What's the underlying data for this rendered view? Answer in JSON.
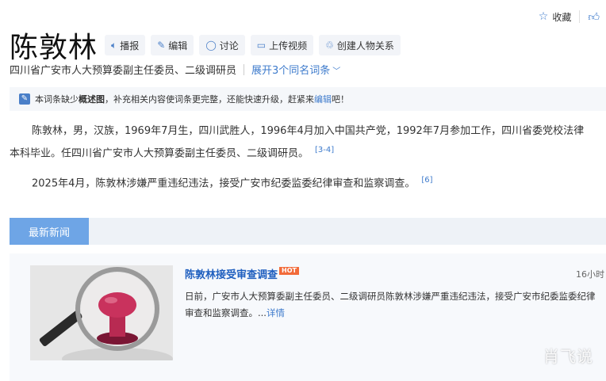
{
  "topbar": {
    "collect_label": "收藏",
    "collect_icon": "star-icon",
    "like_icon": "thumb-up-icon"
  },
  "entry": {
    "title": "陈敦林"
  },
  "actions": [
    {
      "label": "播报",
      "icon": "speaker-icon"
    },
    {
      "label": "编辑",
      "icon": "pencil-icon"
    },
    {
      "label": "讨论",
      "icon": "comment-icon"
    },
    {
      "label": "上传视频",
      "icon": "video-icon"
    },
    {
      "label": "创建人物关系",
      "icon": "people-icon"
    }
  ],
  "subtitle": {
    "text": "四川省广安市人大预算委副主任委员、二级调研员",
    "expand_label": "展开3个同名词条"
  },
  "notice": {
    "prefix": "本词条缺少",
    "bold": "概述图",
    "middle": "，补充相关内容使词条更完整，还能快速升级，赶紧来",
    "link": "编辑",
    "suffix": "吧！"
  },
  "content": {
    "p1_line1": "陈敦林，男，汉族，1969年7月生，四川武胜人，1996年4月加入中国共产党，1992年7月参加工作，四川省委党校法律",
    "p1_line2": "本科毕业。任四川省广安市人大预算委副主任委员、二级调研员。",
    "p1_cite": "[3-4]",
    "p2": "2025年4月，陈敦林涉嫌严重违纪违法，接受广安市纪委监委纪律审查和监察调查。",
    "p2_cite": "[6]"
  },
  "news": {
    "tab_label": "最新新闻",
    "item": {
      "title": "陈敦林接受审查调查",
      "badge": "HOT",
      "time": "16小时",
      "summary": "日前，广安市人大预算委副主任委员、二级调研员陈敦林涉嫌严重违纪违法，接受广安市纪委监委纪律",
      "summary_line2": "审查和监察调查。...",
      "more": "详情"
    }
  },
  "watermark": "肖飞说",
  "colors": {
    "accent": "#3e7bcc",
    "tab": "#6ea5e6",
    "hot": "#f26b3a"
  }
}
